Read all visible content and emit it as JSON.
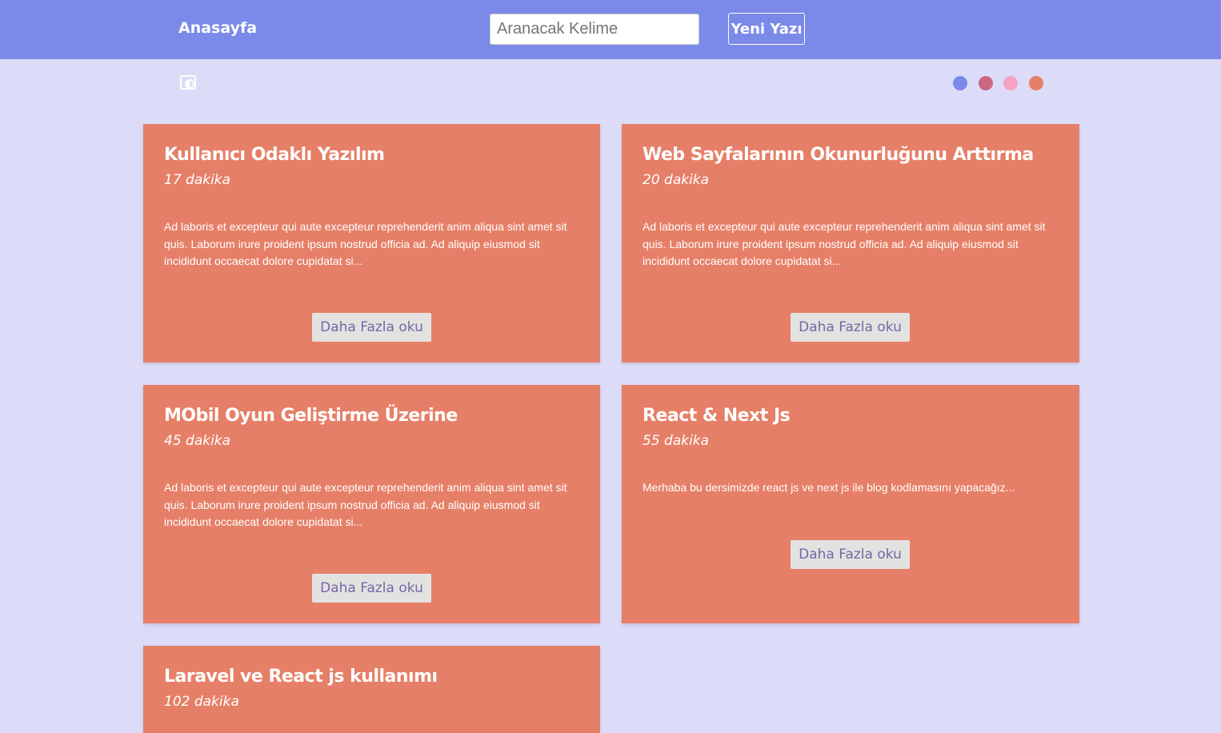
{
  "header": {
    "home_label": "Anasayfa",
    "search_placeholder": "Aranacak Kelime",
    "search_value": "",
    "new_post_label": "Yeni Yazı"
  },
  "theme": {
    "toggle_icon": "contrast-icon",
    "swatches": [
      {
        "name": "blue",
        "color": "#7b8ae9"
      },
      {
        "name": "rose",
        "color": "#cc6783"
      },
      {
        "name": "pink",
        "color": "#f6a3c3"
      },
      {
        "name": "coral",
        "color": "#e67f67"
      }
    ]
  },
  "colors": {
    "header_bg": "#7b8ae9",
    "page_bg": "#dcdcf9",
    "card_bg": "#e67f67",
    "button_bg": "#e3e2e1",
    "button_text": "#7566a6"
  },
  "posts": [
    {
      "title": "Kullanıcı Odaklı Yazılım",
      "duration": "17 dakika",
      "excerpt": "Ad laboris et excepteur qui aute excepteur reprehenderit anim aliqua sint amet sit quis. Laborum irure proident ipsum nostrud officia ad. Ad aliquip eiusmod sit incididunt occaecat dolore cupidatat si...",
      "button": "Daha Fazla oku"
    },
    {
      "title": "Web Sayfalarının Okunurluğunu Arttırma",
      "duration": "20 dakika",
      "excerpt": "Ad laboris et excepteur qui aute excepteur reprehenderit anim aliqua sint amet sit quis. Laborum irure proident ipsum nostrud officia ad. Ad aliquip eiusmod sit incididunt occaecat dolore cupidatat si...",
      "button": "Daha Fazla oku"
    },
    {
      "title": "MObil Oyun Geliştirme Üzerine",
      "duration": "45 dakika",
      "excerpt": "Ad laboris et excepteur qui aute excepteur reprehenderit anim aliqua sint amet sit quis. Laborum irure proident ipsum nostrud officia ad. Ad aliquip eiusmod sit incididunt occaecat dolore cupidatat si...",
      "button": "Daha Fazla oku"
    },
    {
      "title": "React & Next Js",
      "duration": "55 dakika",
      "excerpt": "Merhaba bu dersimizde react js ve next js ile blog kodlamasını yapacağız...",
      "button": "Daha Fazla oku"
    },
    {
      "title": "Laravel ve React js kullanımı",
      "duration": "102 dakika",
      "excerpt": "",
      "button": ""
    }
  ]
}
